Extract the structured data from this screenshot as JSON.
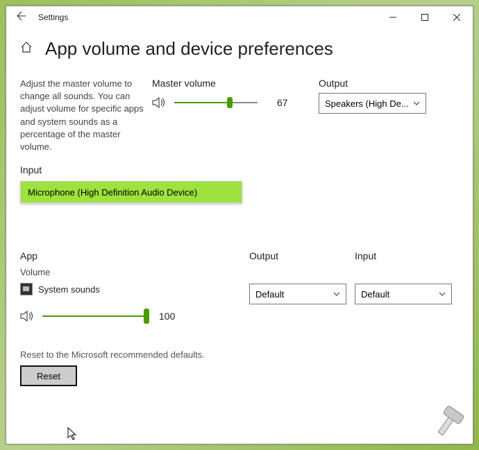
{
  "window": {
    "title": "Settings"
  },
  "page": {
    "title": "App volume and device preferences",
    "description": "Adjust the master volume to change all sounds. You can adjust volume for specific apps and system sounds as a percentage of the master volume."
  },
  "master": {
    "label": "Master volume",
    "value": "67",
    "percent": 67
  },
  "output": {
    "label": "Output",
    "selected": "Speakers (High De..."
  },
  "input": {
    "label": "Input",
    "selected": "Microphone (High Definition Audio Device)"
  },
  "apps": {
    "header_app": "App",
    "header_output": "Output",
    "header_input": "Input",
    "volume_label": "Volume",
    "row": {
      "name": "System sounds",
      "output": "Default",
      "input": "Default",
      "volume": "100"
    }
  },
  "reset": {
    "text": "Reset to the Microsoft recommended defaults.",
    "button": "Reset"
  }
}
